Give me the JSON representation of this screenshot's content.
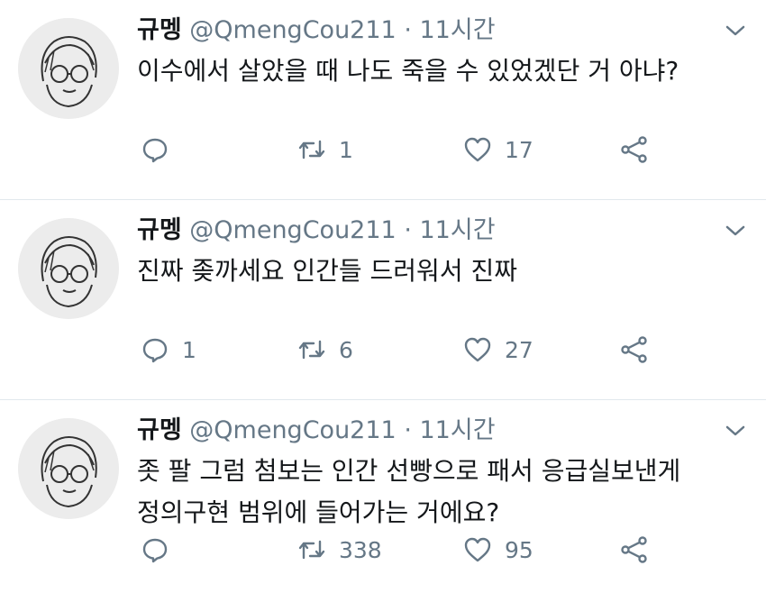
{
  "tweets": [
    {
      "name": "규멩",
      "handle": "@QmengCou211",
      "separator": "·",
      "time": "11시간",
      "lines": [
        "이수에서 살았을 때 나도 죽을 수 있었겠단 거 아냐?"
      ],
      "replies": "",
      "retweets": "1",
      "likes": "17"
    },
    {
      "name": "규멩",
      "handle": "@QmengCou211",
      "separator": "·",
      "time": "11시간",
      "lines": [
        "진짜 좆까세요 인간들 드러워서 진짜"
      ],
      "replies": "1",
      "retweets": "6",
      "likes": "27"
    },
    {
      "name": "규멩",
      "handle": "@QmengCou211",
      "separator": "·",
      "time": "11시간",
      "lines": [
        "좃 팔 그럼 첨보는 인간 선빵으로 패서 응급실보낸게",
        "정의구현 범위에 들어가는 거에요?"
      ],
      "replies": "",
      "retweets": "338",
      "likes": "95"
    }
  ],
  "icons": {
    "reply": "reply-icon",
    "retweet": "retweet-icon",
    "like": "heart-icon",
    "share": "share-icon",
    "menu": "chevron-down-icon",
    "avatar": "avatar-drawing"
  },
  "colors": {
    "text": "#14171a",
    "secondary": "#657786",
    "divider": "#e1e8ed",
    "background": "#ffffff"
  }
}
